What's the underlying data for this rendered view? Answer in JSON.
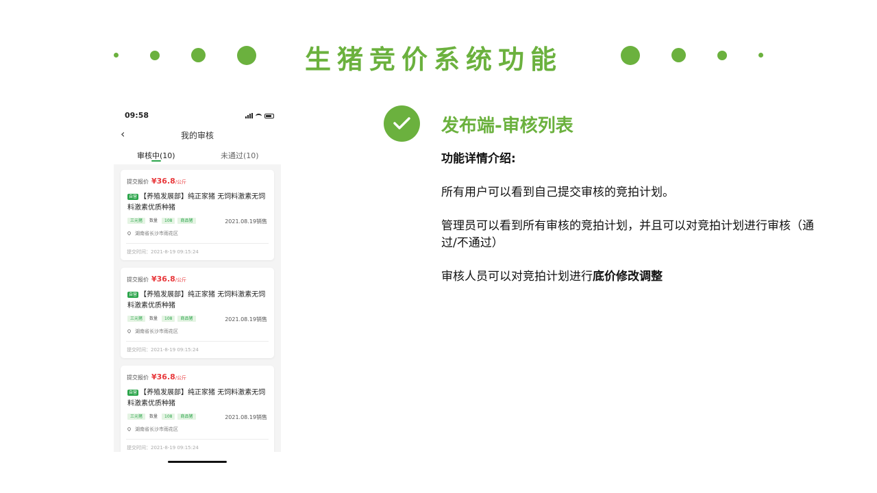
{
  "slide": {
    "title": "生猪竞价系统功能",
    "accent_color": "#6bb13e"
  },
  "phone": {
    "status_time": "09:58",
    "nav_title": "我的审核",
    "back_icon": "chevron-left-icon",
    "tabs": [
      {
        "label": "审核中(10)",
        "active": true
      },
      {
        "label": "未通过(10)",
        "active": false
      }
    ],
    "cards": [
      {
        "price_label": "提交报价",
        "price": "¥36.8",
        "unit": "/公斤",
        "badge": "自营",
        "title": "【养殖发展部】纯正家猪 无饲料激素无饲料激素优质种猪",
        "tags": [
          "三元猪",
          "数量",
          "108",
          "商品猪"
        ],
        "date": "2021.08.19销售",
        "location": "湖南省长沙市雨花区",
        "submit_time": "提交时间：2021-8-19 09:15:24"
      },
      {
        "price_label": "提交报价",
        "price": "¥36.8",
        "unit": "/公斤",
        "badge": "自营",
        "title": "【养殖发展部】纯正家猪 无饲料激素无饲料激素优质种猪",
        "tags": [
          "三元猪",
          "数量",
          "108",
          "商品猪"
        ],
        "date": "2021.08.19销售",
        "location": "湖南省长沙市雨花区",
        "submit_time": "提交时间：2021-8-19 09:15:24"
      },
      {
        "price_label": "提交报价",
        "price": "¥36.8",
        "unit": "/公斤",
        "badge": "自营",
        "title": "【养殖发展部】纯正家猪 无饲料激素无饲料激素优质种猪",
        "tags": [
          "三元猪",
          "数量",
          "108",
          "商品猪"
        ],
        "date": "2021.08.19销售",
        "location": "湖南省长沙市雨花区",
        "submit_time": "提交时间：2021-8-19 09:15:24"
      }
    ]
  },
  "feature": {
    "title": "发布端-审核列表",
    "detail_heading": "功能详情介绍:",
    "p1": "所有用户可以看到自己提交审核的竞拍计划。",
    "p2": "管理员可以看到所有审核的竞拍计划，并且可以对竞拍计划进行审核（通过/不通过）",
    "p3_prefix": "审核人员可以对竞拍计划进行",
    "p3_bold": "底价修改调整"
  }
}
